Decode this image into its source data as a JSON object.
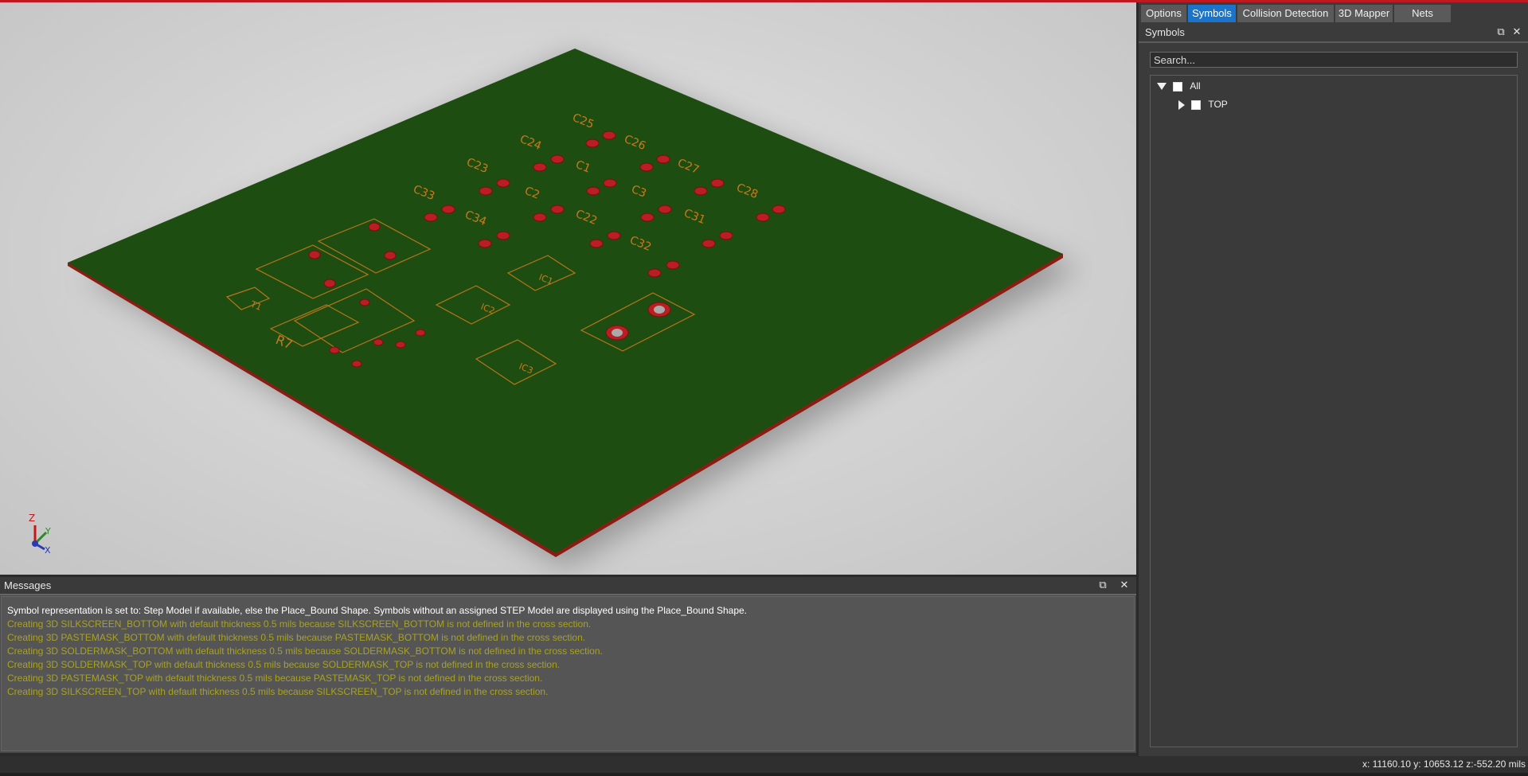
{
  "tabs": [
    {
      "label": "Options",
      "active": false
    },
    {
      "label": "Symbols",
      "active": true
    },
    {
      "label": "Collision Detection",
      "active": false
    },
    {
      "label": "3D Mapper",
      "active": false
    },
    {
      "label": "Nets",
      "active": false
    }
  ],
  "symbols_panel": {
    "title": "Symbols",
    "search_placeholder": "Search...",
    "tree": [
      {
        "label": "All",
        "expanded": true,
        "checked": false
      },
      {
        "label": "TOP",
        "expanded": false,
        "checked": false
      }
    ]
  },
  "viewport": {
    "axis": {
      "z": "Z",
      "y": "Y",
      "x": "X"
    },
    "refdes": [
      "C25",
      "C24",
      "C26",
      "C23",
      "C1",
      "C27",
      "C33",
      "C2",
      "C3",
      "C28",
      "C34",
      "C22",
      "C31",
      "C32",
      "IC1",
      "IC2",
      "IC3",
      "T1",
      "R7"
    ],
    "colors": {
      "board": "#1e4d12",
      "board_edge": "#8a1c14",
      "silk": "#c97a1c",
      "pad": "#b81e22"
    }
  },
  "messages": {
    "title": "Messages",
    "lines": [
      {
        "text": "Symbol representation is set to: Step Model if available, else the Place_Bound Shape.  Symbols without an assigned STEP Model are displayed using the Place_Bound Shape.",
        "level": "info"
      },
      {
        "text": "Creating 3D SILKSCREEN_BOTTOM with default thickness 0.5 mils because SILKSCREEN_BOTTOM is not defined in the cross section.",
        "level": "warn"
      },
      {
        "text": "Creating 3D PASTEMASK_BOTTOM with default thickness 0.5 mils because PASTEMASK_BOTTOM is not defined in the cross section.",
        "level": "warn"
      },
      {
        "text": "Creating 3D SOLDERMASK_BOTTOM with default thickness 0.5 mils because SOLDERMASK_BOTTOM is not defined in the cross section.",
        "level": "warn"
      },
      {
        "text": "Creating 3D SOLDERMASK_TOP with default thickness 0.5 mils because SOLDERMASK_TOP is not defined in the cross section.",
        "level": "warn"
      },
      {
        "text": "Creating 3D PASTEMASK_TOP with default thickness 0.5 mils because PASTEMASK_TOP is not defined in the cross section.",
        "level": "warn"
      },
      {
        "text": "Creating 3D SILKSCREEN_TOP with default thickness 0.5 mils because SILKSCREEN_TOP is not defined in the cross section.",
        "level": "warn"
      }
    ]
  },
  "status": {
    "coordinates": "x: 11160.10 y: 10653.12 z:-552.20 mils"
  }
}
